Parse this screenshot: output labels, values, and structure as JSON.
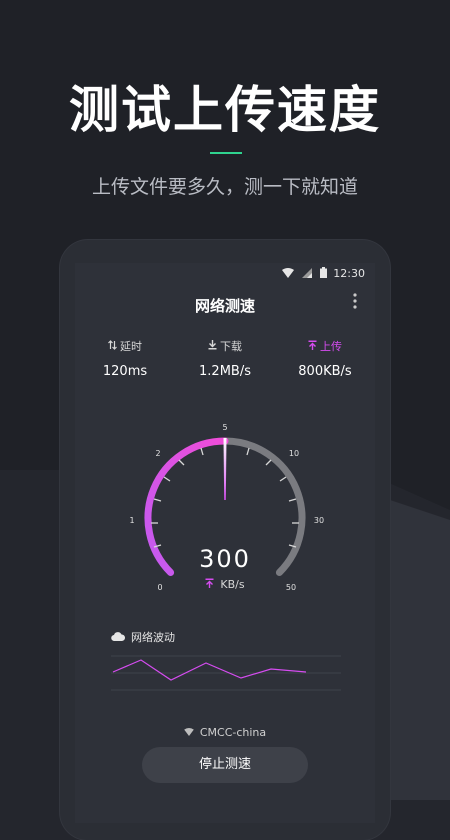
{
  "promo": {
    "headline": "测试上传速度",
    "subline": "上传文件要多久，测一下就知道",
    "accent_color": "#2fd38f"
  },
  "status_bar": {
    "time": "12:30",
    "icons": [
      "wifi-icon",
      "signal-icon",
      "battery-icon"
    ]
  },
  "app": {
    "title": "网络测速",
    "menu_icon": "more-vertical-icon"
  },
  "stats": [
    {
      "label": "延时",
      "value": "120ms",
      "icon": "latency-icon"
    },
    {
      "label": "下载",
      "value": "1.2MB/s",
      "icon": "download-icon"
    },
    {
      "label": "上传",
      "value": "800KB/s",
      "icon": "upload-icon",
      "active": true
    }
  ],
  "gauge": {
    "tick_labels": [
      "0",
      "1",
      "2",
      "5",
      "10",
      "30",
      "50"
    ],
    "value": "300",
    "unit": "KB/s",
    "needle_at_label": "5",
    "active_color": "#d54cf0",
    "track_color": "#7a7b80"
  },
  "wave": {
    "title": "网络波动",
    "icon": "cloud-icon",
    "line_color": "#d54cf0"
  },
  "network": {
    "name": "CMCC-china",
    "icon": "wifi-icon"
  },
  "button": {
    "label": "停止测速"
  }
}
